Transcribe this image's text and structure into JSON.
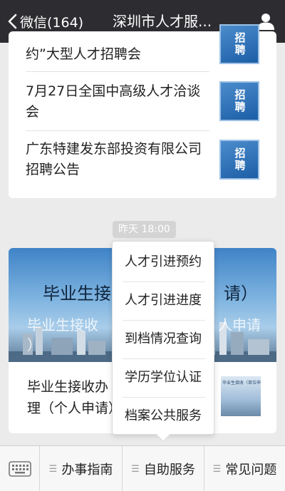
{
  "header": {
    "back_label": "微信(164)",
    "title": "深圳市人才服..."
  },
  "feed": {
    "items": [
      {
        "title": "约”大型人才招聘会",
        "thumb_text": "招聘"
      },
      {
        "title": "7月27日全国中高级人才洽谈会",
        "thumb_text": "招聘"
      },
      {
        "title": "广东特建发东部投资有限公司招聘公告",
        "thumb_text": "招聘"
      }
    ]
  },
  "timestamp": "昨天 18:00",
  "article": {
    "banner_title": "毕业生接",
    "banner_title_tail": "请）",
    "banner_subtitle": "毕业生接收",
    "banner_subtitle_tail": "人申请",
    "banner_subtitle_line2": "）",
    "title": "毕业生接收办理（个人申请）",
    "thumb_caption": "毕业生接收（单位申"
  },
  "popup_menu": {
    "items": [
      "人才引进预约",
      "人才引进进度",
      "到档情况查询",
      "学历学位认证",
      "档案公共服务"
    ]
  },
  "bottom_nav": {
    "items": [
      "办事指南",
      "自助服务",
      "常见问题"
    ]
  },
  "colors": {
    "header_bg": "#2d2d31",
    "page_bg": "#ebebeb"
  }
}
